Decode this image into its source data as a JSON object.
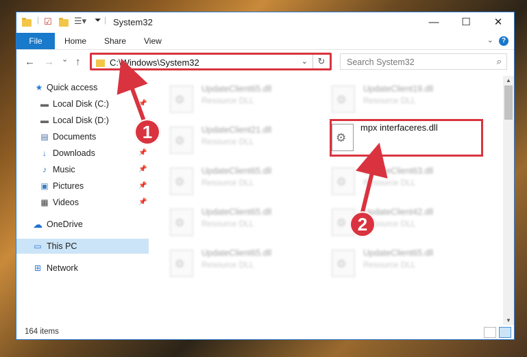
{
  "window": {
    "title": "System32",
    "controls": {
      "minimize": "—",
      "maximize": "☐",
      "close": "✕"
    }
  },
  "ribbon": {
    "tabs": [
      {
        "label": "File"
      },
      {
        "label": "Home"
      },
      {
        "label": "Share"
      },
      {
        "label": "View"
      }
    ],
    "help": "?"
  },
  "navigation": {
    "back": "←",
    "forward": "→",
    "recent": "⌄",
    "up": "↑",
    "address": "C:\\Windows\\System32",
    "refresh": "↻",
    "search_placeholder": "Search System32"
  },
  "sidebar": {
    "items": [
      {
        "label": "Quick access",
        "icon": "star-icon",
        "glyph": "★",
        "color": "#2a7ad5",
        "pinned": false
      },
      {
        "label": "Local Disk (C:)",
        "icon": "drive-icon",
        "glyph": "▬",
        "color": "#666666",
        "pinned": true
      },
      {
        "label": "Local Disk (D:)",
        "icon": "drive-icon",
        "glyph": "▬",
        "color": "#666666",
        "pinned": false
      },
      {
        "label": "Documents",
        "icon": "documents-icon",
        "glyph": "▤",
        "color": "#4a6fa5",
        "pinned": true
      },
      {
        "label": "Downloads",
        "icon": "download-icon",
        "glyph": "↓",
        "color": "#1f6fd1",
        "pinned": true
      },
      {
        "label": "Music",
        "icon": "music-icon",
        "glyph": "♪",
        "color": "#2a7ad5",
        "pinned": true
      },
      {
        "label": "Pictures",
        "icon": "pictures-icon",
        "glyph": "▣",
        "color": "#3f7fbf",
        "pinned": true
      },
      {
        "label": "Videos",
        "icon": "videos-icon",
        "glyph": "▦",
        "color": "#444444",
        "pinned": true
      },
      {
        "label": "OneDrive",
        "icon": "cloud-icon",
        "glyph": "☁",
        "color": "#1f6fd1",
        "pinned": false
      },
      {
        "label": "This PC",
        "icon": "computer-icon",
        "glyph": "▭",
        "color": "#2a7ad5",
        "pinned": false
      },
      {
        "label": "Network",
        "icon": "network-icon",
        "glyph": "⊞",
        "color": "#2a7ad5",
        "pinned": false
      }
    ],
    "pin_glyph": "📌"
  },
  "files": [
    {
      "name": "UpdateClient65.dll",
      "type": "Resource DLL"
    },
    {
      "name": "UpdateClient19.dll",
      "type": "Resource DLL"
    },
    {
      "name": "UpdateClient21.dll",
      "type": "Resource DLL"
    },
    {
      "name": "UpdateClient65.dll",
      "type": "Resource DLL"
    },
    {
      "name": "UpdateClient63.dll",
      "type": "Resource DLL"
    },
    {
      "name": "UpdateClient65.dll",
      "type": "Resource DLL"
    },
    {
      "name": "UpdateClient42.dll",
      "type": "Resource DLL"
    },
    {
      "name": "UpdateClient65.dll",
      "type": "Resource DLL"
    },
    {
      "name": "UpdateClient65.dll",
      "type": "Resource DLL"
    }
  ],
  "highlighted_file": {
    "name": "mpx interfaceres.dll"
  },
  "status": {
    "count": "164 items"
  },
  "annotations": {
    "step1": "1",
    "step2": "2",
    "color": "#d9333f"
  }
}
